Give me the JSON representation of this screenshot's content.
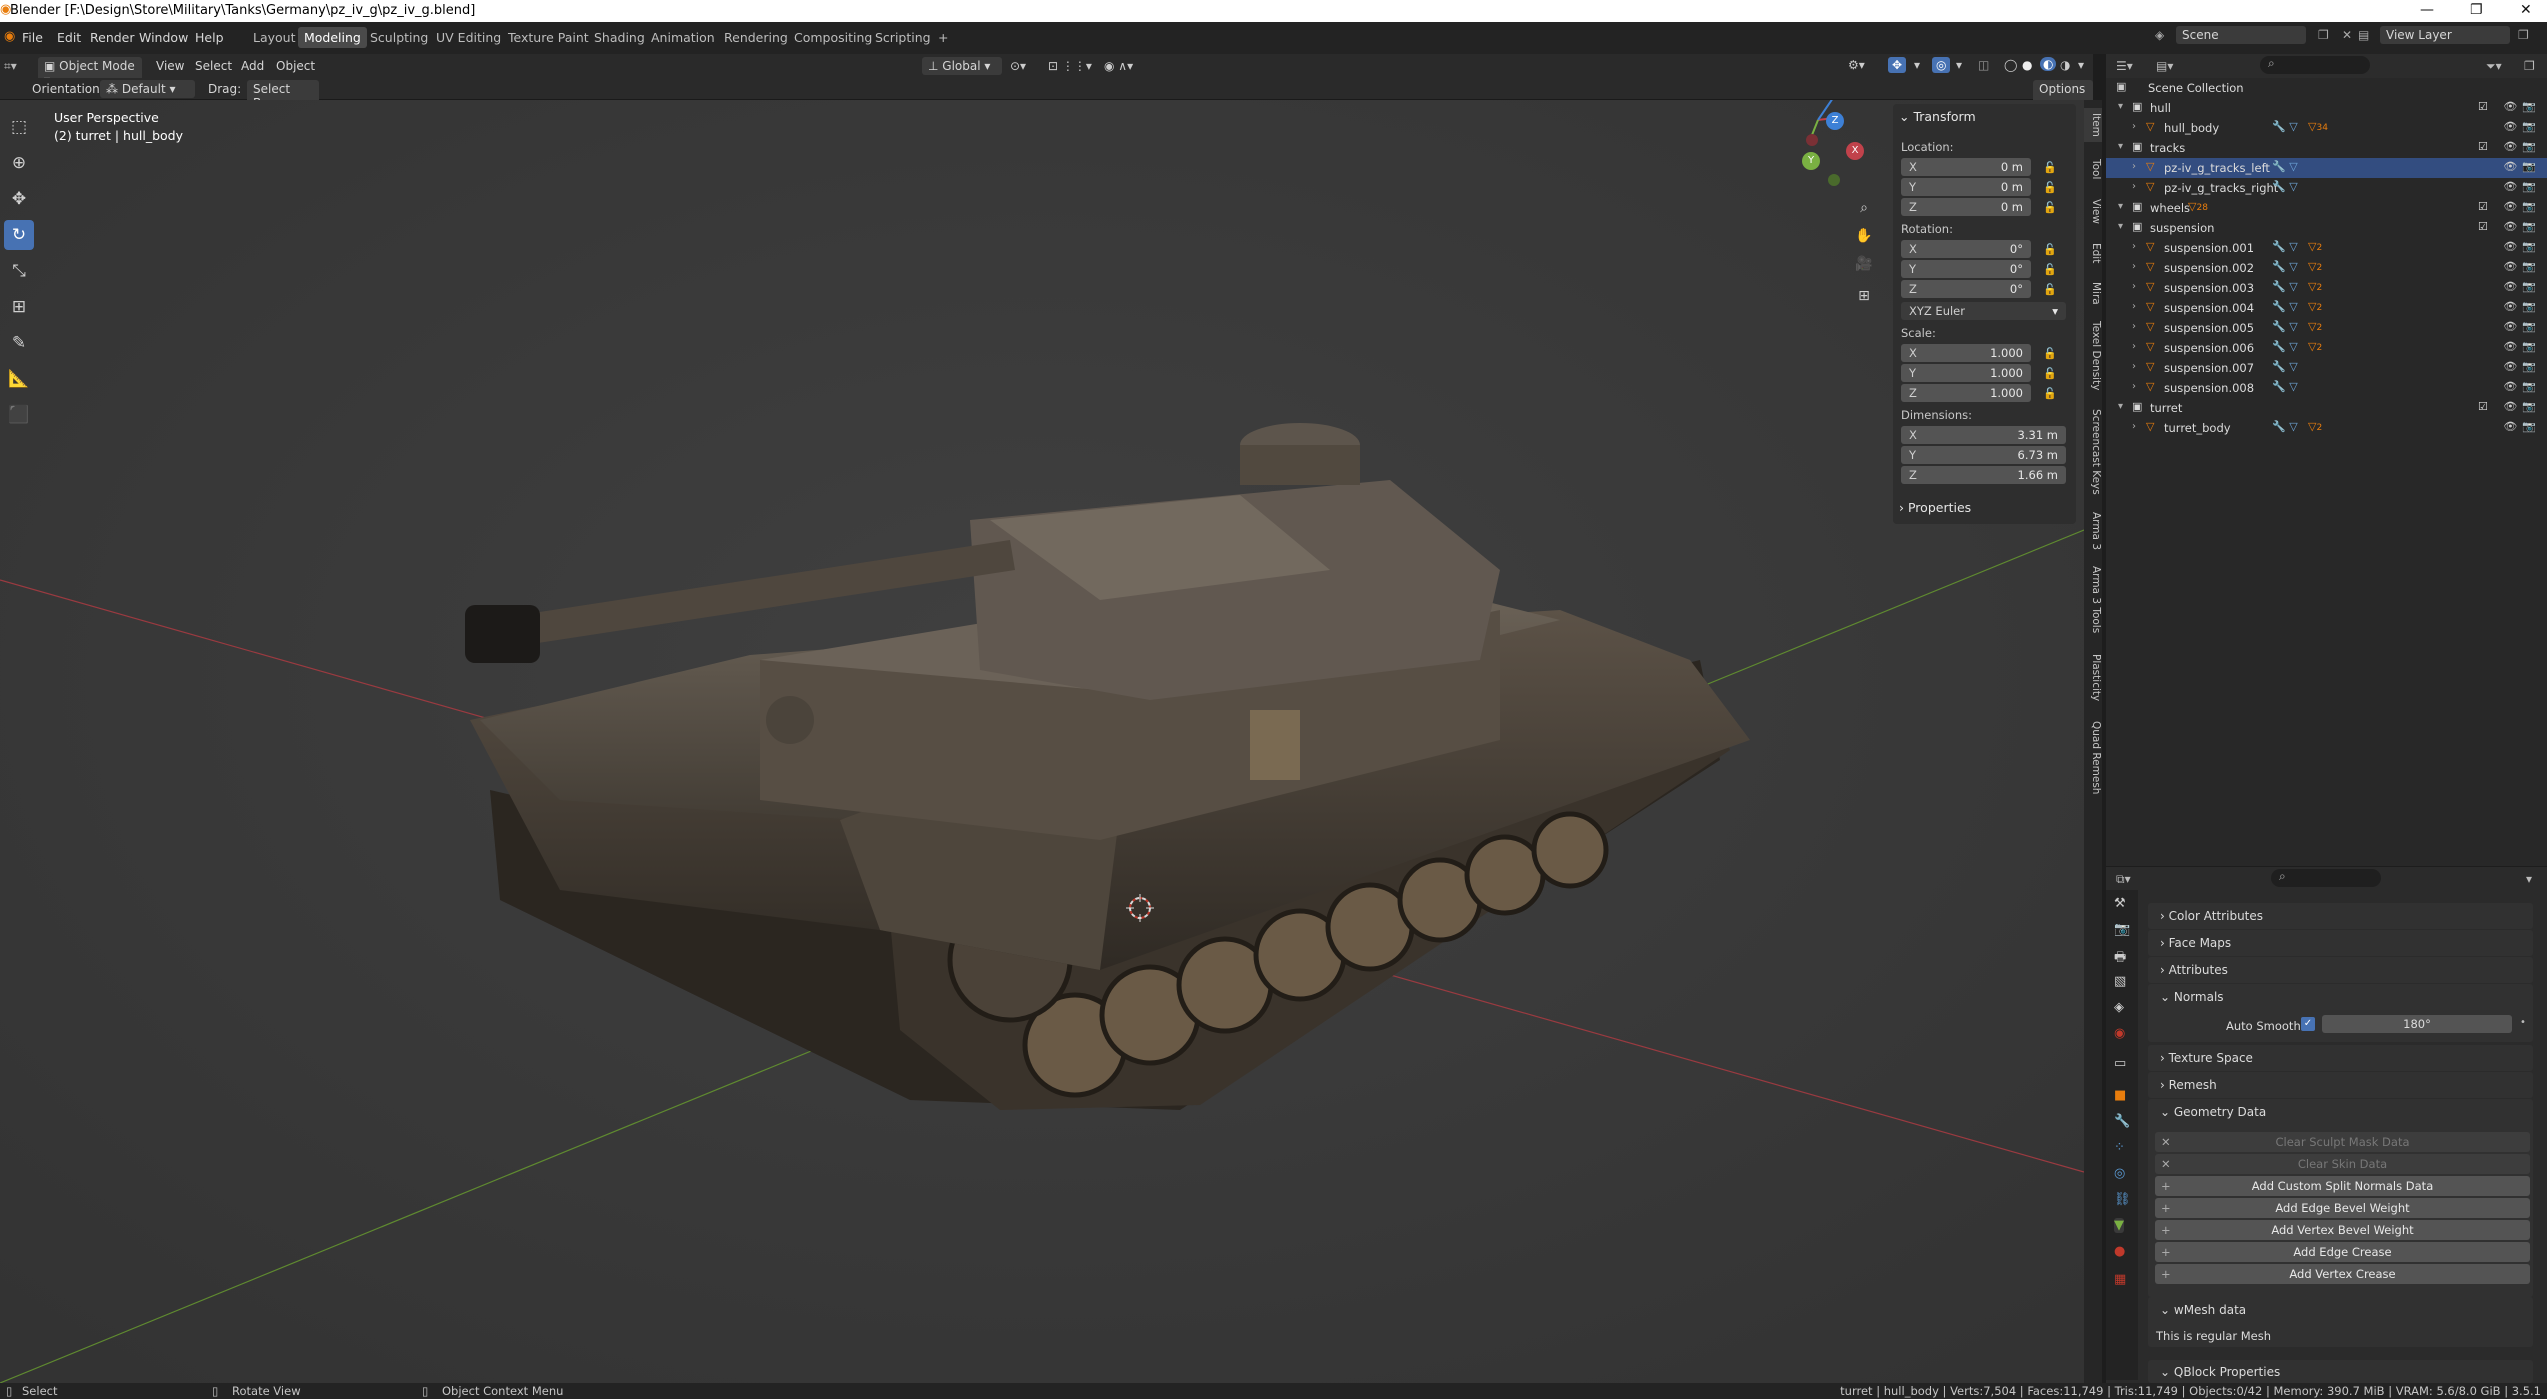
{
  "window": {
    "title": "Blender [F:\\Design\\Store\\Military\\Tanks\\Germany\\pz_iv_g\\pz_iv_g.blend]",
    "minimize": "—",
    "maximize": "❐",
    "close": "✕"
  },
  "menu": [
    "File",
    "Edit",
    "Render",
    "Window",
    "Help"
  ],
  "workspaces": [
    "Layout",
    "Modeling",
    "Sculpting",
    "UV Editing",
    "Texture Paint",
    "Shading",
    "Animation",
    "Rendering",
    "Compositing",
    "Scripting",
    "+"
  ],
  "active_workspace": "Modeling",
  "scene": {
    "name": "Scene",
    "view_layer": "View Layer"
  },
  "viewport_header": {
    "mode": "Object Mode",
    "view": "View",
    "select": "Select",
    "add": "Add",
    "object": "Object",
    "transform_orientation": "Global",
    "orientation_label": "Orientation:",
    "orientation_value": "Default",
    "drag_label": "Drag:",
    "drag_value": "Select Box",
    "options": "Options"
  },
  "viewport": {
    "perspective": "User Perspective",
    "context": "(2) turret | hull_body",
    "gizmo": {
      "x": "X",
      "y": "Y",
      "z": "Z"
    }
  },
  "npanel": {
    "transform_title": "Transform",
    "location_label": "Location:",
    "location": [
      {
        "k": "X",
        "v": "0 m"
      },
      {
        "k": "Y",
        "v": "0 m"
      },
      {
        "k": "Z",
        "v": "0 m"
      }
    ],
    "rotation_label": "Rotation:",
    "rotation": [
      {
        "k": "X",
        "v": "0°"
      },
      {
        "k": "Y",
        "v": "0°"
      },
      {
        "k": "Z",
        "v": "0°"
      }
    ],
    "rotation_mode": "XYZ Euler",
    "scale_label": "Scale:",
    "scale": [
      {
        "k": "X",
        "v": "1.000"
      },
      {
        "k": "Y",
        "v": "1.000"
      },
      {
        "k": "Z",
        "v": "1.000"
      }
    ],
    "dimensions_label": "Dimensions:",
    "dimensions": [
      {
        "k": "X",
        "v": "3.31 m"
      },
      {
        "k": "Y",
        "v": "6.73 m"
      },
      {
        "k": "Z",
        "v": "1.66 m"
      }
    ],
    "properties_title": "Properties"
  },
  "side_tabs": [
    "Item",
    "Tool",
    "View",
    "Edit",
    "Mira",
    "Texel Density",
    "Screencast Keys",
    "Arma 3",
    "Arma 3 Tools",
    "Plasticity",
    "Quad Remesh"
  ],
  "outliner": {
    "root": "Scene Collection",
    "rows": [
      {
        "name": "hull",
        "kind": "collection",
        "level": 0
      },
      {
        "name": "hull_body",
        "kind": "object",
        "level": 1,
        "badge": "34"
      },
      {
        "name": "tracks",
        "kind": "collection",
        "level": 0
      },
      {
        "name": "pz-iv_g_tracks_left",
        "kind": "object",
        "level": 1,
        "selected": true
      },
      {
        "name": "pz-iv_g_tracks_right",
        "kind": "object",
        "level": 1
      },
      {
        "name": "wheels",
        "kind": "collection",
        "level": 0,
        "badge": "28"
      },
      {
        "name": "suspension",
        "kind": "collection",
        "level": 0
      },
      {
        "name": "suspension.001",
        "kind": "object",
        "level": 1,
        "badge": "2"
      },
      {
        "name": "suspension.002",
        "kind": "object",
        "level": 1,
        "badge": "2"
      },
      {
        "name": "suspension.003",
        "kind": "object",
        "level": 1,
        "badge": "2"
      },
      {
        "name": "suspension.004",
        "kind": "object",
        "level": 1,
        "badge": "2"
      },
      {
        "name": "suspension.005",
        "kind": "object",
        "level": 1,
        "badge": "2"
      },
      {
        "name": "suspension.006",
        "kind": "object",
        "level": 1,
        "badge": "2"
      },
      {
        "name": "suspension.007",
        "kind": "object",
        "level": 1
      },
      {
        "name": "suspension.008",
        "kind": "object",
        "level": 1
      },
      {
        "name": "turret",
        "kind": "collection",
        "level": 0
      },
      {
        "name": "turret_body",
        "kind": "object",
        "level": 1,
        "badge": "2"
      }
    ]
  },
  "properties": {
    "sections": [
      "Color Attributes",
      "Face Maps",
      "Attributes",
      "Normals",
      "Texture Space",
      "Remesh",
      "Geometry Data"
    ],
    "auto_smooth_label": "Auto Smooth",
    "auto_smooth_angle": "180°",
    "geometry_buttons": [
      {
        "label": "Clear Sculpt Mask Data",
        "disabled": true,
        "prefix": "✕"
      },
      {
        "label": "Clear Skin Data",
        "disabled": true,
        "prefix": "✕"
      },
      {
        "label": "Add Custom Split Normals Data",
        "disabled": false,
        "prefix": "+"
      },
      {
        "label": "Add Edge Bevel Weight",
        "disabled": false,
        "prefix": "+"
      },
      {
        "label": "Add Vertex Bevel Weight",
        "disabled": false,
        "prefix": "+"
      },
      {
        "label": "Add Edge Crease",
        "disabled": false,
        "prefix": "+"
      },
      {
        "label": "Add Vertex Crease",
        "disabled": false,
        "prefix": "+"
      }
    ],
    "wmesh_title": "wMesh data",
    "wmesh_text": "This is regular Mesh",
    "qblock_title": "QBlock Properties"
  },
  "status": {
    "left": "Select",
    "mid": "Rotate View",
    "ctx": "Object Context Menu",
    "stats": "turret | hull_body | Verts:7,504 | Faces:11,749 | Tris:11,749 | Objects:0/42 | Memory: 390.7 MiB | VRAM: 5.6/8.0 GiB | 3.5.1"
  },
  "colors": {
    "accent": "#4772b3",
    "x_axis": "#c1424b",
    "y_axis": "#7ab142",
    "z_axis": "#3d80d6"
  }
}
